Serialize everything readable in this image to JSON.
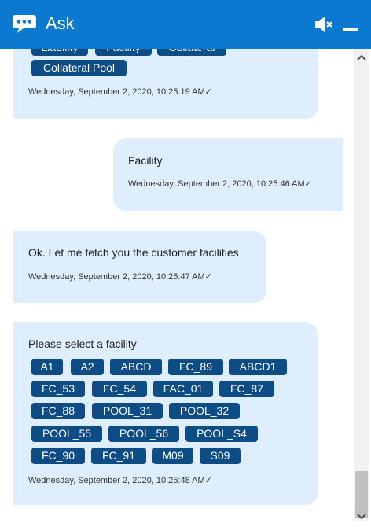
{
  "header": {
    "title": "Ask"
  },
  "messages": {
    "m1": {
      "chips_partial": [
        "Liability",
        "Facility",
        "Collateral"
      ],
      "chip_pool": "Collateral Pool",
      "timestamp": "Wednesday, September 2, 2020, 10:25:19 AM✓"
    },
    "m2": {
      "text": "Facility",
      "timestamp": "Wednesday, September 2, 2020, 10:25:46 AM✓"
    },
    "m3": {
      "text": "Ok. Let me fetch you the customer facilities",
      "timestamp": "Wednesday, September 2, 2020, 10:25:47 AM✓"
    },
    "m4": {
      "prompt": "Please select a facility",
      "options": [
        "A1",
        "A2",
        "ABCD",
        "FC_89",
        "ABCD1",
        "FC_53",
        "FC_54",
        "FAC_01",
        "FC_87",
        "FC_88",
        "POOL_31",
        "POOL_32",
        "POOL_55",
        "POOL_56",
        "POOL_S4",
        "FC_90",
        "FC_91",
        "M09",
        "S09"
      ],
      "timestamp": "Wednesday, September 2, 2020, 10:25:48 AM✓"
    }
  },
  "colors": {
    "header": "#0b79d0",
    "bubble": "#dfeefc",
    "chip": "#0d4c84"
  }
}
